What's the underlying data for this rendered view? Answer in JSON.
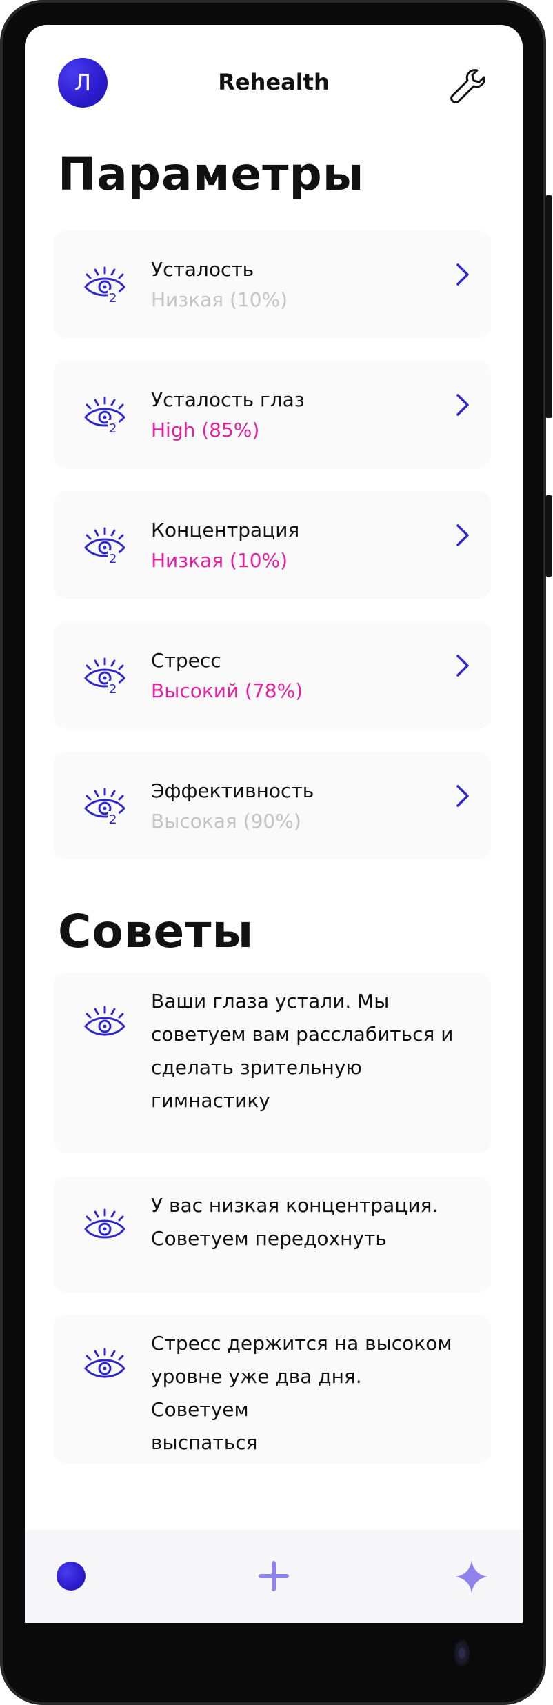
{
  "header": {
    "avatar_letter": "Л",
    "app_title": "Rehealth",
    "settings_icon": "wrench-icon"
  },
  "parameters": {
    "title": "Параметры",
    "items": [
      {
        "name": "Усталость",
        "value": "Низкая (10%)",
        "value_color": "#c4c4c4"
      },
      {
        "name": "Усталость глаз",
        "value": "High (85%)",
        "value_color": "#e5219f"
      },
      {
        "name": "Концентрация",
        "value": "Низкая (10%)",
        "value_color": "#e5219f"
      },
      {
        "name": "Стресс",
        "value": "Высокий (78%)",
        "value_color": "#e5219f"
      },
      {
        "name": "Эффективность",
        "value": "Высокая (90%)",
        "value_color": "#c4c4c4"
      }
    ],
    "item_icon_badge": "2"
  },
  "tips": {
    "title": "Советы",
    "items": [
      {
        "lines": [
          "Ваши глаза устали. Мы",
          "советуем вам расслабиться и",
          "сделать зрительную",
          "гимнастику"
        ]
      },
      {
        "lines": [
          "У вас низкая концентрация.",
          "Советуем передохнуть"
        ]
      },
      {
        "lines": [
          "Стресс держится на высоком",
          "уровне уже два дня. Советуем",
          "выспаться"
        ]
      }
    ]
  },
  "bottom_nav": {
    "items": [
      "profile-dot-icon",
      "add-icon",
      "sparkle-icon"
    ]
  },
  "colors": {
    "accent": "#2a1ccc",
    "icon_blue": "#2f28c9",
    "highlight_pink": "#e5219f",
    "muted_grey": "#c4c4c4",
    "nav_light": "#8e82ee"
  }
}
